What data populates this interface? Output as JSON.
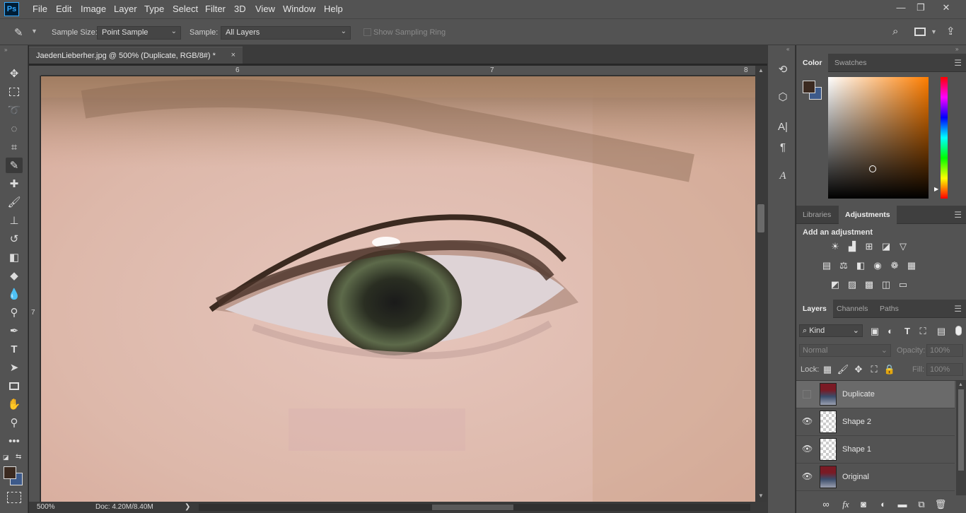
{
  "app": {
    "logo": "Ps"
  },
  "menu": [
    "File",
    "Edit",
    "Image",
    "Layer",
    "Type",
    "Select",
    "Filter",
    "3D",
    "View",
    "Window",
    "Help"
  ],
  "window_controls": {
    "minimize": "—",
    "restore": "❐",
    "close": "✕"
  },
  "options": {
    "sample_size_label": "Sample Size:",
    "sample_size_value": "Point Sample",
    "sample_label": "Sample:",
    "sample_value": "All Layers",
    "show_ring_label": "Show Sampling Ring"
  },
  "document": {
    "tab_title": "JaedenLieberher.jpg @ 500% (Duplicate, RGB/8#) *",
    "close": "×",
    "ruler_top": [
      "6",
      "7",
      "8"
    ],
    "ruler_left": [
      "7"
    ]
  },
  "status": {
    "zoom": "500%",
    "doc": "Doc: 4.20M/8.40M",
    "arrow": "❯"
  },
  "colors": {
    "foreground": "#3b2a20",
    "background": "#3d5a8a",
    "accent": "#31a8ff"
  },
  "panels": {
    "color": {
      "tabs": [
        "Color",
        "Swatches"
      ]
    },
    "adjustments": {
      "tabs": [
        "Libraries",
        "Adjustments"
      ],
      "add_label": "Add an adjustment"
    },
    "layers": {
      "tabs": [
        "Layers",
        "Channels",
        "Paths"
      ],
      "filter_kind": "Kind",
      "blend_mode": "Normal",
      "opacity_label": "Opacity:",
      "opacity_value": "100%",
      "lock_label": "Lock:",
      "fill_label": "Fill:",
      "fill_value": "100%",
      "items": [
        {
          "name": "Duplicate",
          "visible": false,
          "selected": true
        },
        {
          "name": "Shape 2",
          "visible": true,
          "selected": false
        },
        {
          "name": "Shape 1",
          "visible": true,
          "selected": false
        },
        {
          "name": "Original",
          "visible": true,
          "selected": false
        }
      ],
      "footer_fx": "fx"
    }
  }
}
